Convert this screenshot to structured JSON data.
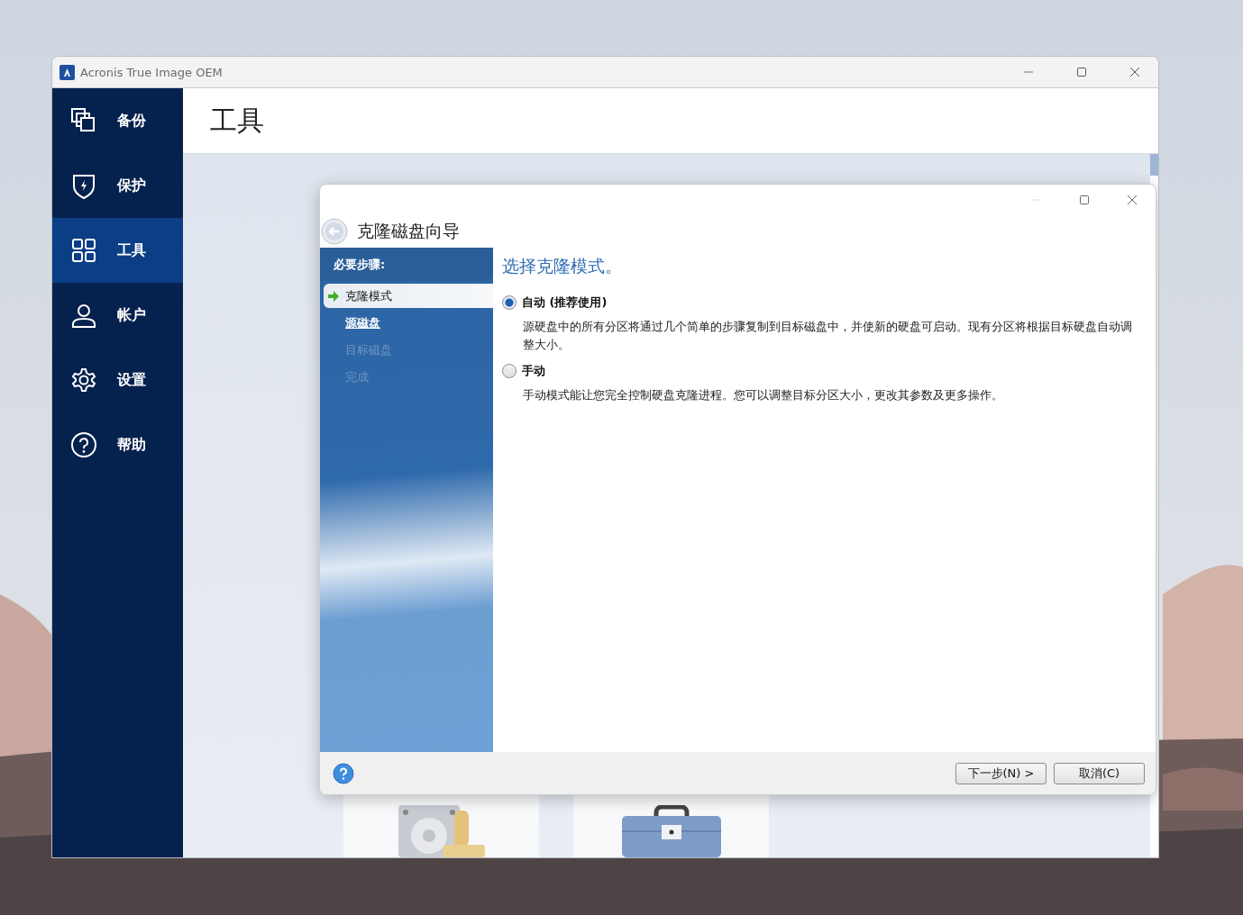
{
  "window": {
    "title": "Acronis True Image OEM"
  },
  "sidebar": {
    "items": [
      {
        "label": "备份",
        "selected": false
      },
      {
        "label": "保护",
        "selected": false
      },
      {
        "label": "工具",
        "selected": true
      },
      {
        "label": "帐户",
        "selected": false
      },
      {
        "label": "设置",
        "selected": false
      },
      {
        "label": "帮助",
        "selected": false
      }
    ]
  },
  "page": {
    "title": "工具"
  },
  "dialog": {
    "title": "克隆磁盘向导",
    "steps_heading": "必要步骤:",
    "steps": [
      {
        "label": "克隆模式",
        "selected": true,
        "disabled": false
      },
      {
        "label": "源磁盘",
        "selected": false,
        "disabled": false
      },
      {
        "label": "目标磁盘",
        "selected": false,
        "disabled": true
      },
      {
        "label": "完成",
        "selected": false,
        "disabled": true
      }
    ],
    "heading": "选择克隆模式。",
    "options": [
      {
        "label": "自动 (推荐使用)",
        "selected": true,
        "description": "源硬盘中的所有分区将通过几个简单的步骤复制到目标磁盘中，并使新的硬盘可启动。现有分区将根据目标硬盘自动调整大小。"
      },
      {
        "label": "手动",
        "selected": false,
        "description": "手动模式能让您完全控制硬盘克隆进程。您可以调整目标分区大小，更改其参数及更多操作。"
      }
    ],
    "buttons": [
      "下一步(N) >",
      "取消(C)"
    ]
  }
}
